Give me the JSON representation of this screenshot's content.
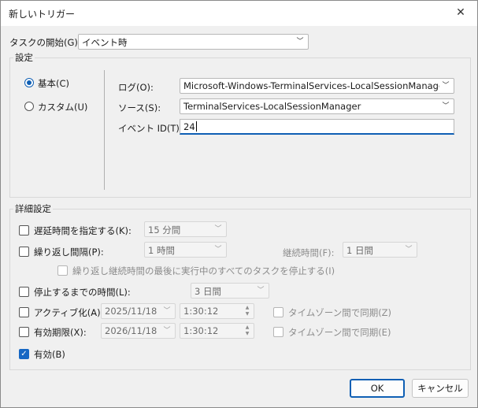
{
  "dialog": {
    "title": "新しいトリガー"
  },
  "start_task": {
    "label": "タスクの開始(G):",
    "value": "イベント時"
  },
  "settings": {
    "group_label": "設定",
    "radio_basic": "基本(C)",
    "radio_custom": "カスタム(U)",
    "log_label": "ログ(O):",
    "log_value": "Microsoft-Windows-TerminalServices-LocalSessionManager/Op",
    "source_label": "ソース(S):",
    "source_value": "TerminalServices-LocalSessionManager",
    "event_id_label": "イベント ID(T):",
    "event_id_value": "24"
  },
  "advanced": {
    "group_label": "詳細設定",
    "delay_label": "遅延時間を指定する(K):",
    "delay_value": "15 分間",
    "repeat_label": "繰り返し間隔(P):",
    "repeat_value": "1 時間",
    "duration_label": "継続時間(F):",
    "duration_value": "1 日間",
    "stop_running_label": "繰り返し継続時間の最後に実行中のすべてのタスクを停止する(I)",
    "stop_after_label": "停止するまでの時間(L):",
    "stop_after_value": "3 日間",
    "activate_label": "アクティブ化(A):",
    "activate_date": "2025/11/18",
    "activate_time": "1:30:12",
    "activate_sync_label": "タイムゾーン間で同期(Z)",
    "expire_label": "有効期限(X):",
    "expire_date": "2026/11/18",
    "expire_time": "1:30:12",
    "expire_sync_label": "タイムゾーン間で同期(E)",
    "enabled_label": "有効(B)"
  },
  "buttons": {
    "ok": "OK",
    "cancel": "キャンセル"
  },
  "colors": {
    "accent": "#0f5fb4",
    "window_bg": "#f0f0f0"
  }
}
